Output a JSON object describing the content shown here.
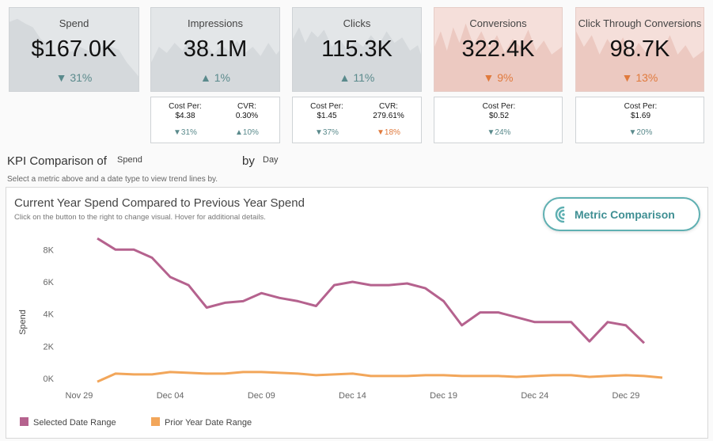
{
  "kpis": [
    {
      "title": "Spend",
      "value": "$167.0K",
      "arrow": "▼",
      "delta": "31%",
      "tone": "down-good",
      "style": "grey"
    },
    {
      "title": "Impressions",
      "value": "38.1M",
      "arrow": "▲",
      "delta": "1%",
      "tone": "up",
      "style": "grey"
    },
    {
      "title": "Clicks",
      "value": "115.3K",
      "arrow": "▲",
      "delta": "11%",
      "tone": "up",
      "style": "grey"
    },
    {
      "title": "Conversions",
      "value": "322.4K",
      "arrow": "▼",
      "delta": "9%",
      "tone": "down-bad",
      "style": "red"
    },
    {
      "title": "Click Through Conversions",
      "value": "98.7K",
      "arrow": "▼",
      "delta": "13%",
      "tone": "down-bad",
      "style": "red"
    }
  ],
  "sub_metrics": {
    "impressions": {
      "cost_label": "Cost Per:",
      "cost_value": "$4.38",
      "cost_delta": "▼31%",
      "cvr_label": "CVR:",
      "cvr_value": "0.30%",
      "cvr_delta": "▲10%"
    },
    "clicks": {
      "cost_label": "Cost Per:",
      "cost_value": "$1.45",
      "cost_delta": "▼37%",
      "cvr_label": "CVR:",
      "cvr_value": "279.61%",
      "cvr_delta": "▼18%"
    },
    "conversions": {
      "cost_label": "Cost Per:",
      "cost_value": "$0.52",
      "cost_delta": "▼24%"
    },
    "ctc": {
      "cost_label": "Cost Per:",
      "cost_value": "$1.69",
      "cost_delta": "▼20%"
    }
  },
  "controls": {
    "kpi_label": "KPI Comparison of",
    "metric_value": "Spend",
    "by_label": "by",
    "date_value": "Day",
    "hint": "Select a metric above and a date type to view trend lines by."
  },
  "panel": {
    "title": "Current Year Spend Compared to Previous Year Spend",
    "subtitle": "Click on the button to the right to change visual. Hover for additional details.",
    "button_label": "Metric Comparison",
    "button_icon": "metric-comparison-icon"
  },
  "colors": {
    "selected": "#b5628e",
    "prior": "#f2a65a",
    "teal": "#5fb0b2",
    "delta_good": "#5a8a8c",
    "delta_bad": "#e07a3d"
  },
  "chart_data": {
    "type": "line",
    "ylabel": "Spend",
    "xlabel": "",
    "ylim": [
      0,
      9000
    ],
    "yticks": [
      0,
      2000,
      4000,
      6000,
      8000
    ],
    "ytick_labels": [
      "0K",
      "2K",
      "4K",
      "6K",
      "8K"
    ],
    "x": [
      "Nov 30",
      "Dec 01",
      "Dec 02",
      "Dec 03",
      "Dec 04",
      "Dec 05",
      "Dec 06",
      "Dec 07",
      "Dec 08",
      "Dec 09",
      "Dec 10",
      "Dec 11",
      "Dec 12",
      "Dec 13",
      "Dec 14",
      "Dec 15",
      "Dec 16",
      "Dec 17",
      "Dec 18",
      "Dec 19",
      "Dec 20",
      "Dec 21",
      "Dec 22",
      "Dec 23",
      "Dec 24",
      "Dec 25",
      "Dec 26",
      "Dec 27",
      "Dec 28",
      "Dec 29",
      "Dec 30",
      "Dec 31"
    ],
    "x_tick_labels": [
      "Nov 29",
      "Dec 04",
      "Dec 09",
      "Dec 14",
      "Dec 19",
      "Dec 24",
      "Dec 29"
    ],
    "x_tick_positions": [
      -1,
      4,
      9,
      14,
      19,
      24,
      29
    ],
    "series": [
      {
        "name": "Selected Date Range",
        "values": [
          8700,
          8000,
          8000,
          7500,
          6300,
          5800,
          4400,
          4700,
          4800,
          5300,
          5000,
          4800,
          4500,
          5800,
          6000,
          5800,
          5800,
          5900,
          5600,
          4800,
          3300,
          4100,
          4100,
          3800,
          3500,
          3500,
          3500,
          2300,
          3500,
          3300,
          2200
        ]
      },
      {
        "name": "Prior Year Date Range",
        "values": [
          -200,
          300,
          250,
          250,
          400,
          350,
          300,
          300,
          400,
          400,
          350,
          300,
          200,
          250,
          300,
          150,
          150,
          150,
          200,
          200,
          150,
          150,
          150,
          100,
          150,
          200,
          200,
          100,
          150,
          200,
          150,
          50
        ]
      }
    ],
    "legend": "bottom"
  }
}
